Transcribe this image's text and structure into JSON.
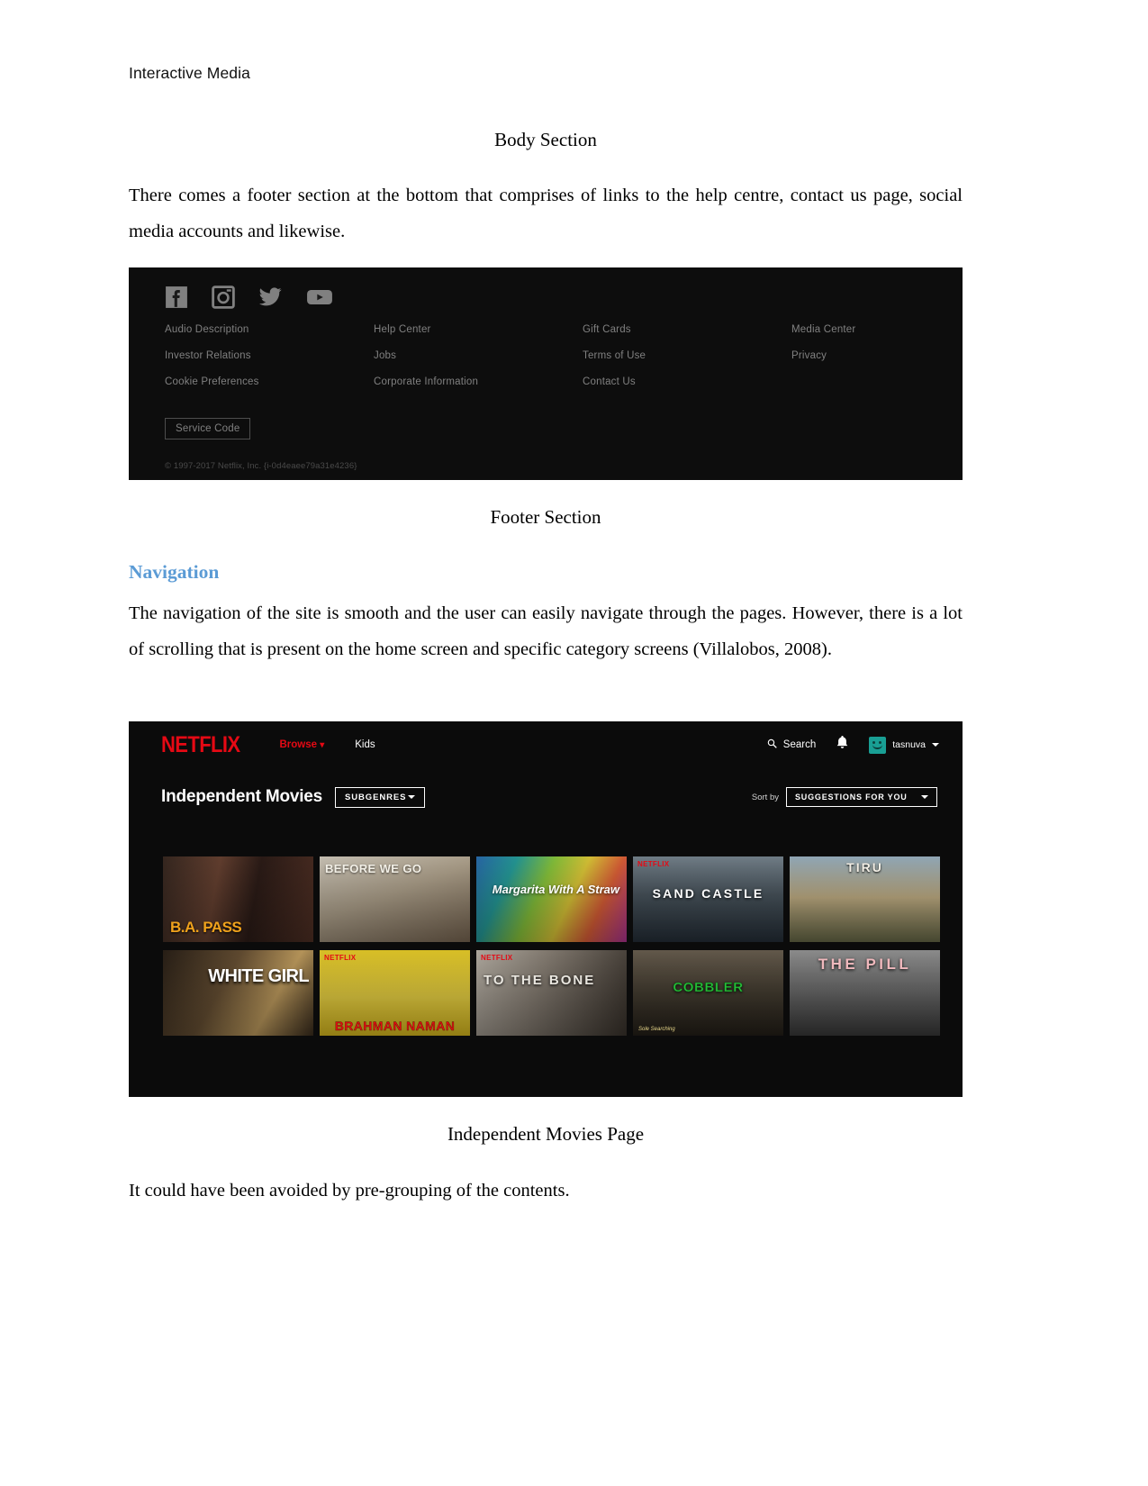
{
  "document": {
    "running_header": "Interactive Media",
    "caption_body": "Body Section",
    "paragraph_1": "There comes a footer section at the bottom that comprises of links to the help centre, contact us page, social media accounts and likewise.",
    "caption_footer": "Footer Section",
    "heading_navigation": "Navigation",
    "paragraph_2": "The navigation of the site is smooth and the user can easily navigate through the pages. However, there is a lot of scrolling that is present on the home screen and specific category screens (Villalobos, 2008).",
    "caption_independent": "Independent Movies Page",
    "paragraph_3": "It could have been avoided by pre-grouping of the contents."
  },
  "footer_screenshot": {
    "social_icons": [
      "facebook-icon",
      "instagram-icon",
      "twitter-icon",
      "youtube-icon"
    ],
    "links": [
      "Audio Description",
      "Help Center",
      "Gift Cards",
      "Media Center",
      "Investor Relations",
      "Jobs",
      "Terms of Use",
      "Privacy",
      "Cookie Preferences",
      "Corporate Information",
      "Contact Us",
      ""
    ],
    "service_code_label": "Service Code",
    "copyright": "© 1997-2017 Netflix, Inc. {i-0d4eaee79a31e4236}",
    "background_color": "#0d0d0d",
    "link_color": "#808080"
  },
  "browse_screenshot": {
    "logo": "NETFLIX",
    "nav": {
      "browse": "Browse",
      "kids": "Kids",
      "search": "Search",
      "user": "tasnuva"
    },
    "genre": {
      "title": "Independent Movies",
      "subgenres_button": "SUBGENRES",
      "sort_by_label": "Sort by",
      "sort_by_value": "SUGGESTIONS FOR YOU"
    },
    "brand_color": "#e50914",
    "avatar_color": "#199f94",
    "tiles": [
      {
        "title": "B.A. PASS",
        "badge": ""
      },
      {
        "title": "BEFORE WE GO",
        "badge": ""
      },
      {
        "title": "Margarita With A Straw",
        "badge": ""
      },
      {
        "title": "SAND CASTLE",
        "badge": "NETFLIX"
      },
      {
        "title": "TIRU",
        "badge": ""
      },
      {
        "title": "WHITE GIRL",
        "badge": ""
      },
      {
        "title": "BRAHMAN NAMAN",
        "badge": "NETFLIX"
      },
      {
        "title": "TO THE BONE",
        "badge": "NETFLIX"
      },
      {
        "title": "COBBLER",
        "badge": "",
        "subtitle": "Sole Searching"
      },
      {
        "title": "THE PILL",
        "badge": ""
      }
    ]
  }
}
